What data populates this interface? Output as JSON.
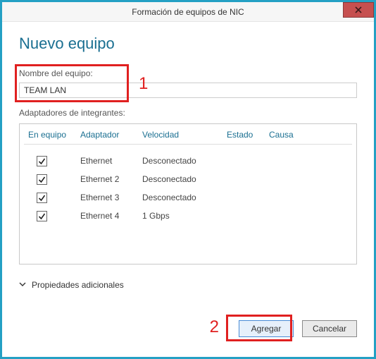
{
  "window": {
    "title": "Formación de equipos de NIC"
  },
  "page": {
    "heading": "Nuevo equipo"
  },
  "team_name": {
    "label": "Nombre del equipo:",
    "value": "TEAM LAN"
  },
  "members": {
    "label": "Adaptadores de integrantes:"
  },
  "columns": {
    "in_team": "En equipo",
    "adapter": "Adaptador",
    "speed": "Velocidad",
    "state": "Estado",
    "cause": "Causa"
  },
  "adapters": [
    {
      "checked": true,
      "name": "Ethernet",
      "speed": "Desconectado",
      "state": "",
      "cause": ""
    },
    {
      "checked": true,
      "name": "Ethernet 2",
      "speed": "Desconectado",
      "state": "",
      "cause": ""
    },
    {
      "checked": true,
      "name": "Ethernet 3",
      "speed": "Desconectado",
      "state": "",
      "cause": ""
    },
    {
      "checked": true,
      "name": "Ethernet 4",
      "speed": "1 Gbps",
      "state": "",
      "cause": ""
    }
  ],
  "expander": {
    "label": "Propiedades adicionales"
  },
  "buttons": {
    "ok": "Agregar",
    "cancel": "Cancelar"
  },
  "annotations": {
    "n1": "1",
    "n2": "2"
  }
}
